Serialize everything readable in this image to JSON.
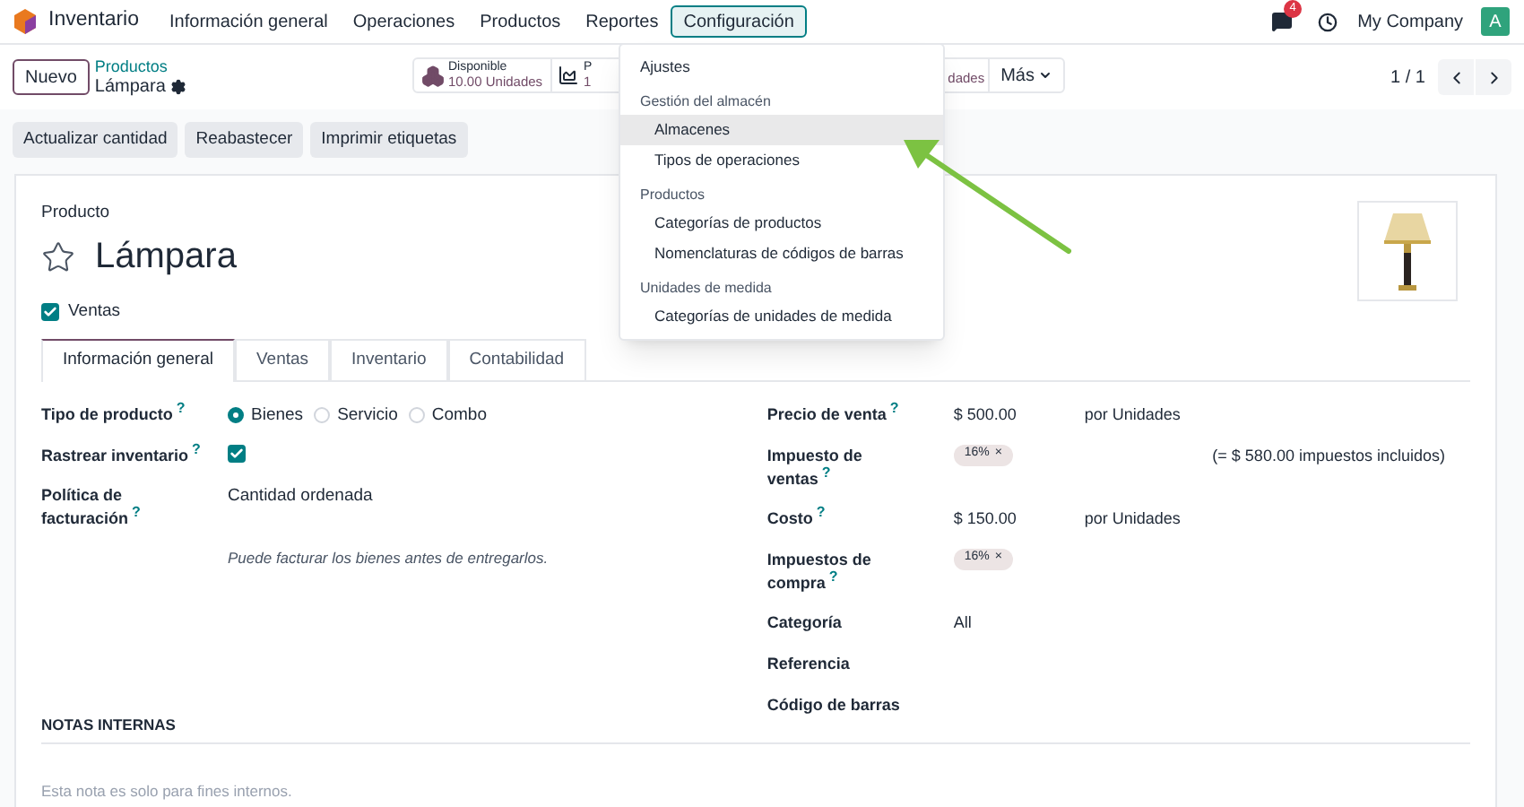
{
  "navbar": {
    "app_name": "Inventario",
    "menus": [
      {
        "label": "Información general",
        "selected": false
      },
      {
        "label": "Operaciones",
        "selected": false
      },
      {
        "label": "Productos",
        "selected": false
      },
      {
        "label": "Reportes",
        "selected": false
      },
      {
        "label": "Configuración",
        "selected": true
      }
    ],
    "message_count": "4",
    "company": "My Company",
    "avatar_letter": "A"
  },
  "control_panel": {
    "new_button": "Nuevo",
    "breadcrumb": "Productos",
    "record_name": "Lámpara",
    "smart_buttons": [
      {
        "kind": "stock",
        "title": "Disponible",
        "value": "10.00 Unidades"
      },
      {
        "kind": "chart",
        "title": "P",
        "value": "1"
      },
      {
        "kind": "partial",
        "value": "dades"
      }
    ],
    "more_button": "Más",
    "pager": "1 / 1"
  },
  "actions": [
    "Actualizar cantidad",
    "Reabastecer",
    "Imprimir etiquetas"
  ],
  "dropdown": {
    "sections": [
      {
        "items": [
          {
            "label": "Ajustes",
            "selected": false
          }
        ]
      },
      {
        "title": "Gestión del almacén",
        "items": [
          {
            "label": "Almacenes",
            "selected": true
          },
          {
            "label": "Tipos de operaciones",
            "selected": false
          }
        ]
      },
      {
        "title": "Productos",
        "items": [
          {
            "label": "Categorías de productos",
            "selected": false
          },
          {
            "label": "Nomenclaturas de códigos de barras",
            "selected": false
          }
        ]
      },
      {
        "title": "Unidades de medida",
        "items": [
          {
            "label": "Categorías de unidades de medida",
            "selected": false
          }
        ]
      }
    ]
  },
  "form": {
    "type_label": "Producto",
    "name": "Lámpara",
    "favorite": false,
    "sales_checkbox": {
      "label": "Ventas",
      "checked": true
    },
    "tabs": [
      {
        "label": "Información general",
        "selected": true
      },
      {
        "label": "Ventas",
        "selected": false
      },
      {
        "label": "Inventario",
        "selected": false
      },
      {
        "label": "Contabilidad",
        "selected": false
      }
    ],
    "left_fields": [
      {
        "kind": "radio",
        "label": "Tipo de producto",
        "help_mark": "?",
        "options": [
          {
            "label": "Bienes",
            "selected": true
          },
          {
            "label": "Servicio",
            "selected": false
          },
          {
            "label": "Combo",
            "selected": false
          }
        ]
      },
      {
        "kind": "checkbox",
        "label": "Rastrear inventario",
        "help_mark": "?",
        "checked": true
      },
      {
        "kind": "text",
        "label": "Política de facturación",
        "help_mark": "?",
        "value": "Cantidad ordenada",
        "note": "Puede facturar los bienes antes de entregarlos."
      }
    ],
    "right_fields": [
      {
        "kind": "money",
        "label": "Precio de venta",
        "help_mark": "?",
        "value": "$ 500.00",
        "unit": "por Unidades"
      },
      {
        "kind": "tag",
        "label": "Impuesto de ventas",
        "help_mark": "?",
        "tag": "16%",
        "remove": "×",
        "note": "(= $ 580.00 impuestos incluidos)"
      },
      {
        "kind": "money",
        "label": "Costo",
        "help_mark": "?",
        "value": "$ 150.00",
        "unit": "por Unidades"
      },
      {
        "kind": "tag",
        "label": "Impuestos de compra",
        "help_mark": "?",
        "tag": "16%",
        "remove": "×"
      },
      {
        "kind": "text",
        "label": "Categoría",
        "value": "All"
      },
      {
        "kind": "text",
        "label": "Referencia"
      },
      {
        "kind": "text",
        "label": "Código de barras"
      }
    ],
    "notes_title": "NOTAS INTERNAS",
    "notes_placeholder": "Esta nota es solo para fines internos."
  }
}
